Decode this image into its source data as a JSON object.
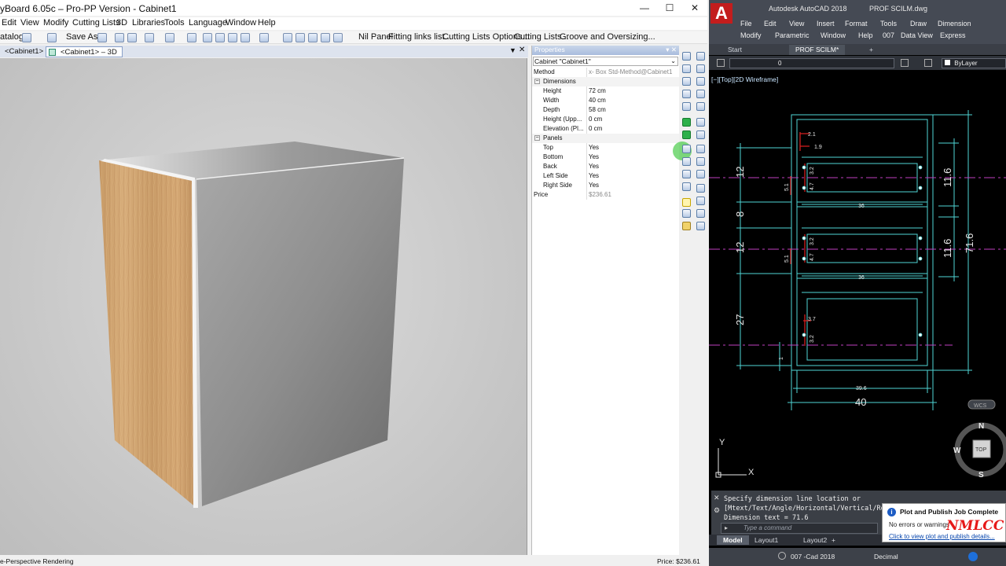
{
  "polyboard": {
    "window_title": "yBoard 6.05c – Pro-PP Version - Cabinet1",
    "window_controls": {
      "minimize": "—",
      "maximize": "☐",
      "close": "✕"
    },
    "menu": [
      "Edit",
      "View",
      "Modify",
      "Cutting Lists",
      "3D",
      "Libraries",
      "Tools",
      "Language",
      "Window",
      "Help"
    ],
    "toolbar": {
      "catalog": "atalog",
      "save_as": "Save As...",
      "nil_panel": "Nil Panel",
      "fitting_links": "Fitting links list...",
      "cutting_options": "Cutting Lists Options...",
      "cutting_lists": "Cutting Lists...",
      "groove": "Groove and Oversizing..."
    },
    "tabs": [
      {
        "label": "<Cabinet1>",
        "active": false
      },
      {
        "label": "<Cabinet1> – 3D",
        "active": true
      }
    ],
    "tab_controls": {
      "dropdown": "▼",
      "close": "✕"
    },
    "properties": {
      "panel_title": "Properties",
      "panel_controls": "▾ ✕",
      "object": "Cabinet \"Cabinet1\"",
      "method_label": "Method",
      "method_value": "x- Box Std-Method@Cabinet1",
      "groups": [
        {
          "name": "Dimensions",
          "rows": [
            {
              "key": "Height",
              "value": "72 cm"
            },
            {
              "key": "Width",
              "value": "40 cm"
            },
            {
              "key": "Depth",
              "value": "58 cm"
            },
            {
              "key": "Height (Upp...",
              "value": "0 cm"
            },
            {
              "key": "Elevation (Pl...",
              "value": "0 cm"
            }
          ]
        },
        {
          "name": "Panels",
          "rows": [
            {
              "key": "Top",
              "value": "Yes"
            },
            {
              "key": "Bottom",
              "value": "Yes"
            },
            {
              "key": "Back",
              "value": "Yes"
            },
            {
              "key": "Left Side",
              "value": "Yes"
            },
            {
              "key": "Right Side",
              "value": "Yes"
            }
          ]
        }
      ],
      "price_label": "Price",
      "price_value": "$236.61"
    },
    "status": {
      "left": "e-Perspective Rendering",
      "right": "Price: $236.61"
    }
  },
  "autocad": {
    "logo": "A",
    "title": "Autodesk AutoCAD 2018",
    "filename": "PROF SCILM.dwg",
    "menu_row1": [
      "File",
      "Edit",
      "View",
      "Insert",
      "Format",
      "Tools",
      "Draw",
      "Dimension"
    ],
    "menu_row2": [
      "Modify",
      "Parametric",
      "Window",
      "Help",
      "007",
      "Data View",
      "Express"
    ],
    "tabs": [
      "Start",
      "PROF SCILM*"
    ],
    "tab_add": "+",
    "layer_value": "0",
    "bylayer": "ByLayer",
    "viewport_label": "[−][Top][2D Wireframe]",
    "dimensions": {
      "h12a": "12",
      "h8": "8",
      "h12b": "12",
      "h27": "27",
      "v11_6a": "11.6",
      "v11_6b": "11.6",
      "v71_6": "71.6",
      "w36a": "36",
      "w36b": "36",
      "w39_6": "39.6",
      "w40": "40",
      "d2_1": "2.1",
      "d1_9": "1.9",
      "d3_2a": "3.2",
      "d4_7a": "4.7",
      "d5_1a": "5.1",
      "d3_2b": "3.2",
      "d4_7b": "4.7",
      "d5_1b": "5.1",
      "d3_7": "3.7",
      "d3_2c": "3.2",
      "d1": "1"
    },
    "ucs": {
      "x": "X",
      "y": "Y"
    },
    "wcs": "WCS",
    "navcube": {
      "n": "N",
      "s": "S",
      "w": "W",
      "face": "TOP"
    },
    "command_lines": [
      "Specify dimension line location or",
      "[Mtext/Text/Angle/Horizontal/Vertical/Ro",
      "Dimension text = 71.6"
    ],
    "command_placeholder": "Type a command",
    "layout_tabs": [
      "Model",
      "Layout1",
      "Layout2"
    ],
    "layout_add": "+",
    "status_scale": "007 -Cad 2018",
    "status_units": "Decimal",
    "notification": {
      "title": "Plot and Publish Job Complete",
      "body": "No errors or warnings",
      "link": "Click to view plot and publish details..."
    },
    "watermark": "NMLCC"
  },
  "colors": {
    "autocad_bg": "#000000",
    "drawing_lines": "#4fd6d6",
    "dimension_text": "#e8e8e8",
    "centerline": "#c040c0",
    "marker": "#e02020",
    "accent_red": "#c31d1d"
  }
}
